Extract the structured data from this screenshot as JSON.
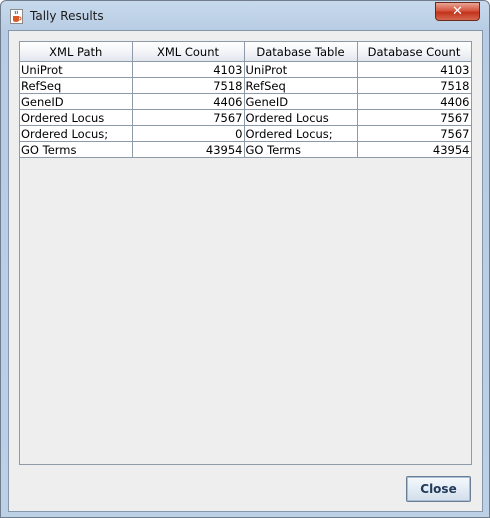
{
  "window": {
    "title": "Tally Results",
    "close_glyph": "✕"
  },
  "table": {
    "columns": [
      "XML Path",
      "XML Count",
      "Database Table",
      "Database Count"
    ],
    "rows": [
      {
        "xml_path": "UniProt",
        "xml_count": "4103",
        "db_table": "UniProt",
        "db_count": "4103"
      },
      {
        "xml_path": "RefSeq",
        "xml_count": "7518",
        "db_table": "RefSeq",
        "db_count": "7518"
      },
      {
        "xml_path": "GeneID",
        "xml_count": "4406",
        "db_table": "GeneID",
        "db_count": "4406"
      },
      {
        "xml_path": "Ordered Locus",
        "xml_count": "7567",
        "db_table": "Ordered Locus",
        "db_count": "7567"
      },
      {
        "xml_path": "Ordered Locus;",
        "xml_count": "0",
        "db_table": "Ordered Locus;",
        "db_count": "7567"
      },
      {
        "xml_path": "GO Terms",
        "xml_count": "43954",
        "db_table": "GO Terms",
        "db_count": "43954"
      }
    ]
  },
  "buttons": {
    "close_label": "Close"
  },
  "icons": {
    "app": "java-cup-icon",
    "window_close": "close-icon"
  }
}
